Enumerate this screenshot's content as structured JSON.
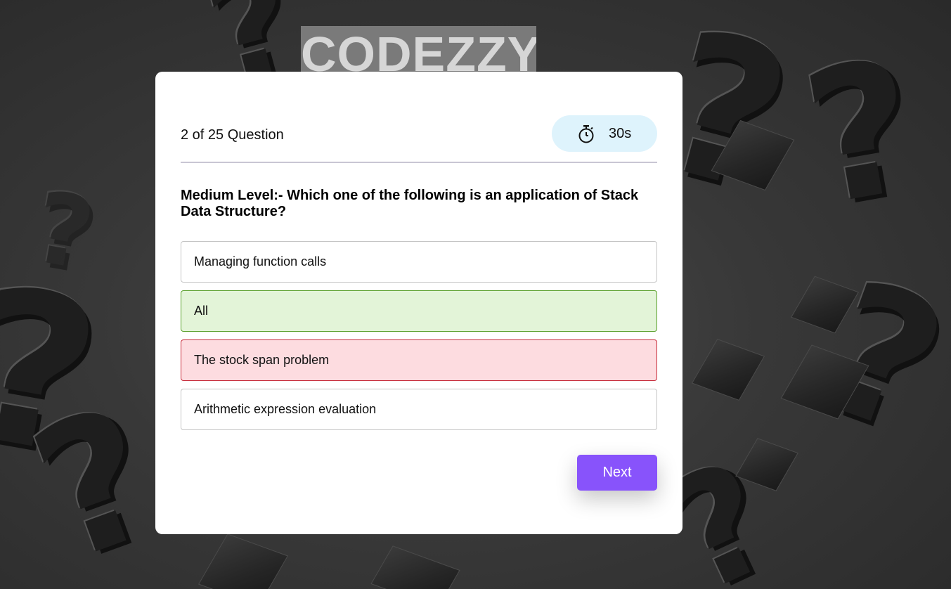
{
  "brand": {
    "name": "CODEZZY"
  },
  "quiz": {
    "counter": "2 of 25 Question",
    "timer": "30s",
    "question": "Medium Level:- Which one of the following is an application of Stack Data Structure?",
    "options": [
      {
        "label": "Managing function calls",
        "state": "default"
      },
      {
        "label": "All",
        "state": "correct"
      },
      {
        "label": "The stock span problem",
        "state": "wrong"
      },
      {
        "label": "Arithmetic expression evaluation",
        "state": "default"
      }
    ],
    "next_label": "Next"
  },
  "colors": {
    "accent": "#8853fb",
    "timer_bg": "#def3fc",
    "correct_bg": "#e3f4d8",
    "correct_border": "#5aa02c",
    "wrong_bg": "#fddce0",
    "wrong_border": "#c62b3a"
  },
  "icons": {
    "timer": "stopwatch-icon",
    "background": "question-mark-pattern"
  }
}
